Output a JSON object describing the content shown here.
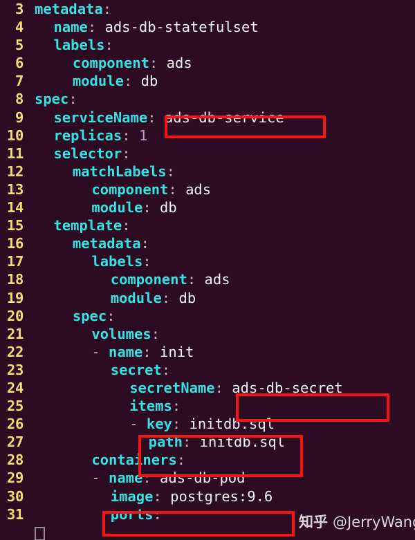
{
  "editor": {
    "language": "yaml",
    "filetype_hint": "kubernetes-statefulset",
    "first_line_number": 3,
    "colors": {
      "background": "#2d0b22",
      "line_number": "#f2dd72",
      "key": "#34e2e2",
      "value": "#f1f1f1",
      "punctuation": "#c8b8c4",
      "number": "#c39ac9",
      "highlight_box": "#f41616",
      "cursor": "#9b8b96"
    },
    "cursor": {
      "line": 31,
      "column": 1
    }
  },
  "lines": [
    {
      "n": "3",
      "indent": 0,
      "key": "metadata",
      "colon": ":",
      "value": ""
    },
    {
      "n": "4",
      "indent": 2,
      "key": "name",
      "colon": ":",
      "value": " ads-db-statefulset"
    },
    {
      "n": "5",
      "indent": 2,
      "key": "labels",
      "colon": ":",
      "value": ""
    },
    {
      "n": "6",
      "indent": 4,
      "key": "component",
      "colon": ":",
      "value": " ads"
    },
    {
      "n": "7",
      "indent": 4,
      "key": "module",
      "colon": ":",
      "value": " db"
    },
    {
      "n": "8",
      "indent": 0,
      "key": "spec",
      "colon": ":",
      "value": ""
    },
    {
      "n": "9",
      "indent": 2,
      "key": "serviceName",
      "colon": ":",
      "value": " ads-db-service"
    },
    {
      "n": "10",
      "indent": 2,
      "key": "replicas",
      "colon": ":",
      "value": " 1",
      "value_kind": "number"
    },
    {
      "n": "11",
      "indent": 2,
      "key": "selector",
      "colon": ":",
      "value": ""
    },
    {
      "n": "12",
      "indent": 4,
      "key": "matchLabels",
      "colon": ":",
      "value": ""
    },
    {
      "n": "13",
      "indent": 6,
      "key": "component",
      "colon": ":",
      "value": " ads"
    },
    {
      "n": "14",
      "indent": 6,
      "key": "module",
      "colon": ":",
      "value": " db"
    },
    {
      "n": "15",
      "indent": 2,
      "key": "template",
      "colon": ":",
      "value": ""
    },
    {
      "n": "16",
      "indent": 4,
      "key": "metadata",
      "colon": ":",
      "value": ""
    },
    {
      "n": "17",
      "indent": 6,
      "key": "labels",
      "colon": ":",
      "value": ""
    },
    {
      "n": "18",
      "indent": 8,
      "key": "component",
      "colon": ":",
      "value": " ads"
    },
    {
      "n": "19",
      "indent": 8,
      "key": "module",
      "colon": ":",
      "value": " db"
    },
    {
      "n": "20",
      "indent": 4,
      "key": "spec",
      "colon": ":",
      "value": ""
    },
    {
      "n": "21",
      "indent": 6,
      "key": "volumes",
      "colon": ":",
      "value": ""
    },
    {
      "n": "22",
      "indent": 6,
      "dash": "- ",
      "key": "name",
      "colon": ":",
      "value": " init"
    },
    {
      "n": "23",
      "indent": 8,
      "key": "secret",
      "colon": ":",
      "value": ""
    },
    {
      "n": "24",
      "indent": 10,
      "key": "secretName",
      "colon": ":",
      "value": " ads-db-secret"
    },
    {
      "n": "25",
      "indent": 10,
      "key": "items",
      "colon": ":",
      "value": ""
    },
    {
      "n": "26",
      "indent": 10,
      "dash": "- ",
      "key": "key",
      "colon": ":",
      "value": " initdb.sql"
    },
    {
      "n": "27",
      "indent": 12,
      "key": "path",
      "colon": ":",
      "value": " initdb.sql"
    },
    {
      "n": "28",
      "indent": 6,
      "key": "containers",
      "colon": ":",
      "value": ""
    },
    {
      "n": "29",
      "indent": 6,
      "dash": "- ",
      "key": "name",
      "colon": ":",
      "value": " ads-db-pod"
    },
    {
      "n": "30",
      "indent": 8,
      "key": "image",
      "colon": ":",
      "value": " postgres:9.6"
    },
    {
      "n": "31",
      "indent": 8,
      "key": "ports",
      "colon": ":",
      "value": ""
    }
  ],
  "highlights": [
    {
      "id": "hl-service",
      "label": "ads-db-service",
      "target_line": "9"
    },
    {
      "id": "hl-secret",
      "label": "ads-db-secret",
      "target_line": "24"
    },
    {
      "id": "hl-items",
      "label": "key/path initdb.sql",
      "target_line": "26-27"
    },
    {
      "id": "hl-image",
      "label": "postgres:9.6",
      "target_line": "30"
    }
  ],
  "watermark": {
    "logo": "知乎",
    "user": "@JerryWang"
  }
}
